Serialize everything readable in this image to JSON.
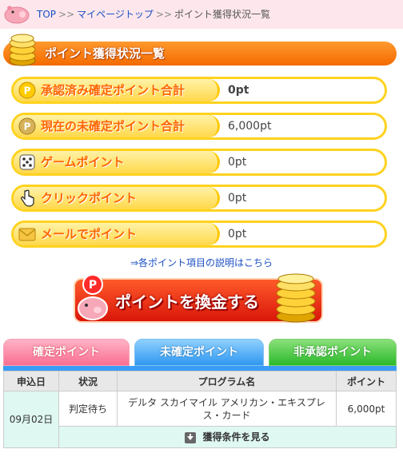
{
  "breadcrumb": {
    "items": [
      "TOP",
      "マイページトップ"
    ],
    "separator": ">>",
    "current": "ポイント獲得状況一覧"
  },
  "page_title": "ポイント獲得状況一覧",
  "summary": [
    {
      "label": "承認済み確定ポイント合計",
      "value": "0pt",
      "icon": "p-coin-icon"
    },
    {
      "label": "現在の未確定ポイント合計",
      "value": "6,000pt",
      "icon": "p-coin-icon"
    },
    {
      "label": "ゲームポイント",
      "value": "0pt",
      "icon": "dice-icon"
    },
    {
      "label": "クリックポイント",
      "value": "0pt",
      "icon": "cursor-hand-icon"
    },
    {
      "label": "メールでポイント",
      "value": "0pt",
      "icon": "mail-icon"
    }
  ],
  "explain_link": "⇒各ポイント項目の説明はこちら",
  "cash_button": "ポイントを換金する",
  "tabs": [
    "確定ポイント",
    "未確定ポイント",
    "非承認ポイント"
  ],
  "table": {
    "headers": [
      "申込日",
      "状況",
      "プログラム名",
      "ポイント"
    ],
    "rows": [
      {
        "date": "09月02日",
        "status": "判定待ち",
        "program": "デルタ スカイマイル アメリカン・エキスプレス・カード",
        "points": "6,000pt",
        "condition": "獲得条件を見る"
      }
    ]
  },
  "colors": {
    "accent_orange": "#f46a00",
    "tab_pink": "#f96e92",
    "tab_blue": "#2f98f0",
    "tab_green": "#2ab92a"
  }
}
